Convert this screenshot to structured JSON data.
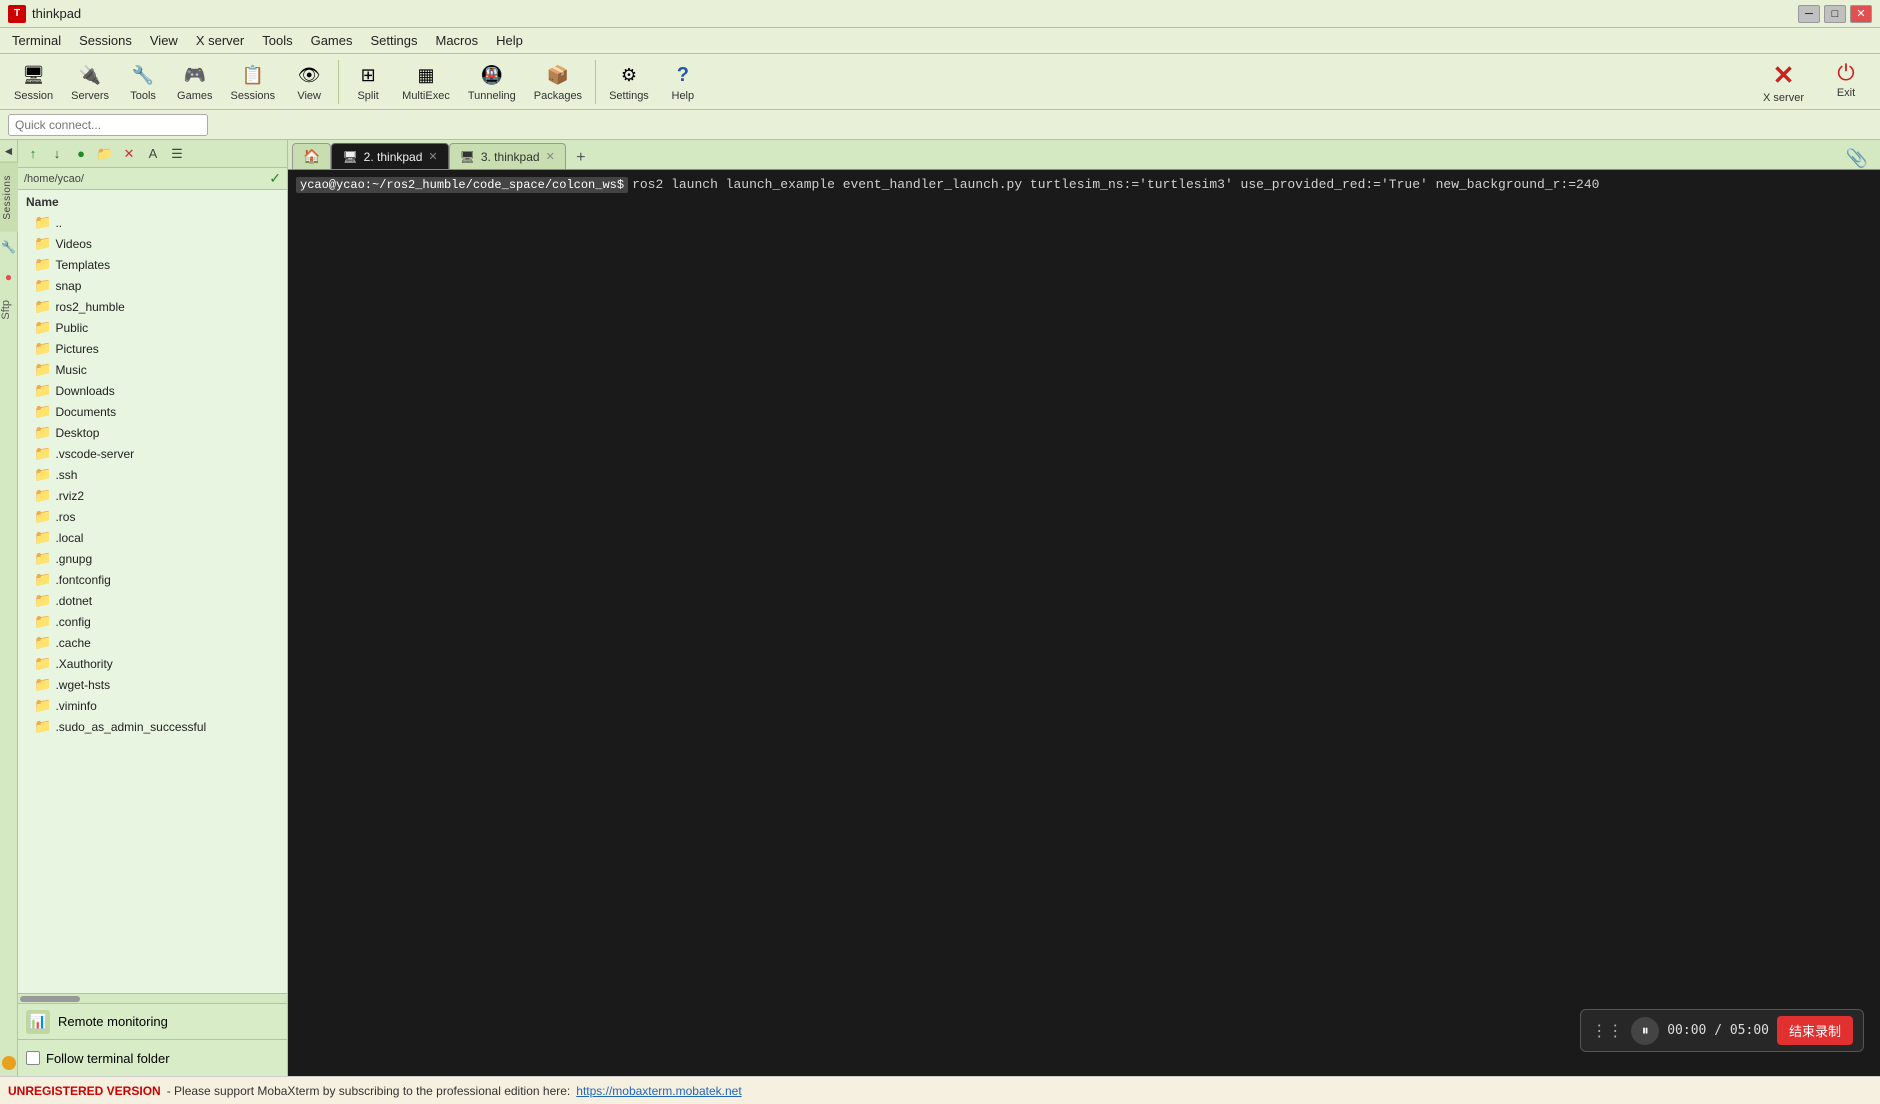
{
  "titleBar": {
    "appName": "thinkpad",
    "winBtnMin": "─",
    "winBtnMax": "□",
    "winBtnClose": "✕"
  },
  "menuBar": {
    "items": [
      "Terminal",
      "Sessions",
      "View",
      "X server",
      "Tools",
      "Games",
      "Settings",
      "Macros",
      "Help"
    ]
  },
  "toolbar": {
    "items": [
      {
        "label": "Session",
        "icon": "🖥"
      },
      {
        "label": "Servers",
        "icon": "🔌"
      },
      {
        "label": "Tools",
        "icon": "🔧"
      },
      {
        "label": "Games",
        "icon": "🎮"
      },
      {
        "label": "Sessions",
        "icon": "📋"
      },
      {
        "label": "View",
        "icon": "👁"
      },
      {
        "label": "Split",
        "icon": "⊞"
      },
      {
        "label": "MultiExec",
        "icon": "▦"
      },
      {
        "label": "Tunneling",
        "icon": "🚇"
      },
      {
        "label": "Packages",
        "icon": "📦"
      },
      {
        "label": "Settings",
        "icon": "⚙"
      },
      {
        "label": "Help",
        "icon": "?"
      }
    ],
    "rightItems": [
      {
        "label": "X server",
        "icon": "✕",
        "iconColor": "#cc2222"
      },
      {
        "label": "Exit",
        "icon": "⏻",
        "iconColor": "#cc2222"
      }
    ]
  },
  "quickConnect": {
    "placeholder": "Quick connect..."
  },
  "vertTabs": {
    "items": [
      "Sessions",
      "Tools",
      "Macros",
      "Sftp"
    ]
  },
  "filePanelToolbar": {
    "buttons": [
      "↑",
      "↓",
      "●",
      "📁",
      "✕",
      "A",
      "☰"
    ]
  },
  "pathBar": {
    "path": "/home/ycao/"
  },
  "fileTree": {
    "header": "Name",
    "items": [
      {
        "label": "..",
        "type": "parent",
        "depth": 0
      },
      {
        "label": "Videos",
        "type": "folder",
        "depth": 1
      },
      {
        "label": "Templates",
        "type": "folder",
        "depth": 1
      },
      {
        "label": "snap",
        "type": "folder",
        "depth": 1
      },
      {
        "label": "ros2_humble",
        "type": "folder",
        "depth": 1
      },
      {
        "label": "Public",
        "type": "folder",
        "depth": 1
      },
      {
        "label": "Pictures",
        "type": "folder",
        "depth": 1
      },
      {
        "label": "Music",
        "type": "folder",
        "depth": 1
      },
      {
        "label": "Downloads",
        "type": "folder",
        "depth": 1
      },
      {
        "label": "Documents",
        "type": "folder",
        "depth": 1
      },
      {
        "label": "Desktop",
        "type": "folder",
        "depth": 1
      },
      {
        "label": ".vscode-server",
        "type": "folder_dark",
        "depth": 1
      },
      {
        "label": ".ssh",
        "type": "folder_dark",
        "depth": 1
      },
      {
        "label": ".rviz2",
        "type": "folder_dark",
        "depth": 1
      },
      {
        "label": ".ros",
        "type": "folder_dark",
        "depth": 1
      },
      {
        "label": ".local",
        "type": "folder_dark",
        "depth": 1
      },
      {
        "label": ".gnupg",
        "type": "folder_dark",
        "depth": 1
      },
      {
        "label": ".fontconfig",
        "type": "folder_dark",
        "depth": 1
      },
      {
        "label": ".dotnet",
        "type": "folder_dark",
        "depth": 1
      },
      {
        "label": ".config",
        "type": "folder_dark",
        "depth": 1
      },
      {
        "label": ".cache",
        "type": "folder_dark",
        "depth": 1
      },
      {
        "label": ".Xauthority",
        "type": "folder_dark",
        "depth": 1
      },
      {
        "label": ".wget-hsts",
        "type": "folder_dark",
        "depth": 1
      },
      {
        "label": ".viminfo",
        "type": "folder_dark",
        "depth": 1
      },
      {
        "label": ".sudo_as_admin_successful",
        "type": "folder_dark",
        "depth": 1
      }
    ]
  },
  "remoteMonitoring": {
    "label": "Remote monitoring",
    "iconColor": "#4a8a4a"
  },
  "followFolder": {
    "label": "Follow terminal folder",
    "checked": false
  },
  "tabs": [
    {
      "id": "home",
      "icon": "🏠",
      "active": false
    },
    {
      "id": "tab2",
      "label": "2. thinkpad",
      "active": true,
      "closable": true
    },
    {
      "id": "tab3",
      "label": "3. thinkpad",
      "active": false,
      "closable": true
    }
  ],
  "terminal": {
    "promptPath": "ycao@ycao:~/ros2_humble/code_space/colcon_ws$",
    "command": "ros2 launch launch_example event_handler_launch.py turtlesim_ns:='turtlesim3' use_provided_red:='True' new_background_r:=240",
    "cursorVisible": true
  },
  "recording": {
    "timerDisplay": "00:00 / 05:00",
    "stopButtonLabel": "结束录制"
  },
  "statusBar": {
    "unregisteredLabel": "UNREGISTERED VERSION",
    "message": " -  Please support MobaXterm by subscribing to the professional edition here: ",
    "linkText": "https://mobaxterm.mobatek.net",
    "linkUrl": "https://mobaxterm.mobatek.net"
  }
}
